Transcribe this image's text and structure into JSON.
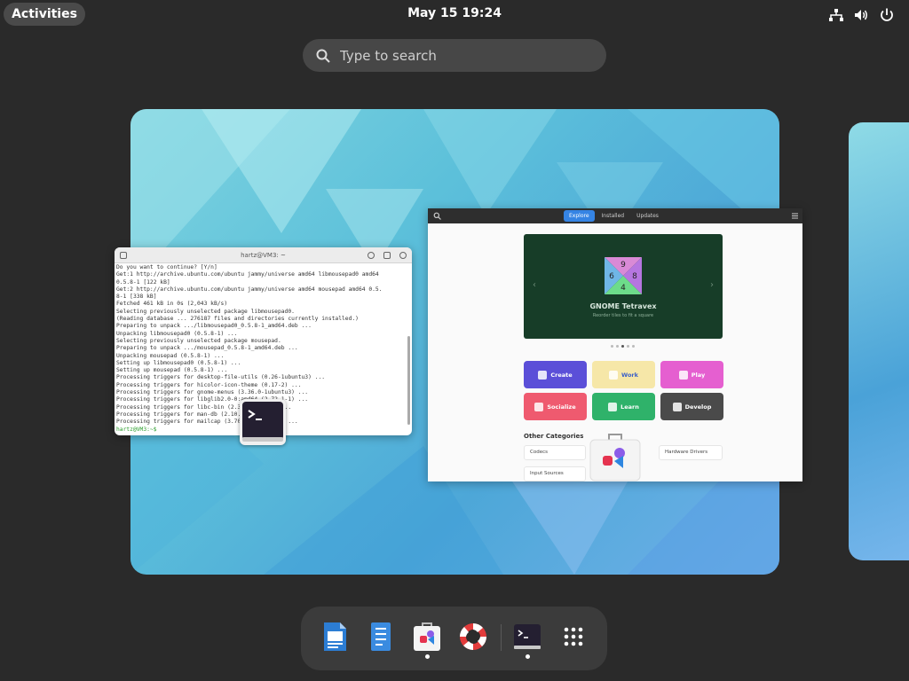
{
  "topbar": {
    "activities_label": "Activities",
    "clock": "May 15  19:24",
    "tray_icons": [
      "network-icon",
      "volume-icon",
      "power-icon"
    ]
  },
  "search": {
    "placeholder": "Type to search"
  },
  "windows": {
    "terminal": {
      "title": "hartz@VM3: ~",
      "lines": [
        "Do you want to continue? [Y/n]",
        "Get:1 http://archive.ubuntu.com/ubuntu jammy/universe amd64 libmousepad0 amd64",
        "0.5.8-1 [122 kB]",
        "Get:2 http://archive.ubuntu.com/ubuntu jammy/universe amd64 mousepad amd64 0.5.",
        "8-1 [338 kB]",
        "Fetched 461 kB in 0s (2,043 kB/s)",
        "Selecting previously unselected package libmousepad0.",
        "(Reading database ... 276187 files and directories currently installed.)",
        "Preparing to unpack .../libmousepad0_0.5.8-1_amd64.deb ...",
        "Unpacking libmousepad0 (0.5.8-1) ...",
        "Selecting previously unselected package mousepad.",
        "Preparing to unpack .../mousepad_0.5.8-1_amd64.deb ...",
        "Unpacking mousepad (0.5.8-1) ...",
        "Setting up libmousepad0 (0.5.8-1) ...",
        "Setting up mousepad (0.5.8-1) ...",
        "Processing triggers for desktop-file-utils (0.26-1ubuntu3) ...",
        "Processing triggers for hicolor-icon-theme (0.17-2) ...",
        "Processing triggers for gnome-menus (3.36.0-1ubuntu3) ...",
        "Processing triggers for libglib2.0-0:amd64 (2.72.1-1) ...",
        "Processing triggers for libc-bin (2.35-0ubuntu3) ...",
        "Processing triggers for man-db (2.10.2-1) ...",
        "Processing triggers for mailcap (3.70+nmu1ubuntu1) ..."
      ],
      "prompt": "hartz@VM3:~$ "
    },
    "software": {
      "tabs": [
        "Explore",
        "Installed",
        "Updates"
      ],
      "featured_title": "GNOME Tetravex",
      "featured_subtitle": "Reorder tiles to fit a square",
      "tile_digits": [
        "9",
        "6",
        "8",
        "4"
      ],
      "categories": [
        {
          "label": "Create",
          "color": "#5b4fd8"
        },
        {
          "label": "Work",
          "color": "#f6e7a8"
        },
        {
          "label": "Play",
          "color": "#e55fd0"
        },
        {
          "label": "Socialize",
          "color": "#ef5a6f"
        },
        {
          "label": "Learn",
          "color": "#2fb26a"
        },
        {
          "label": "Develop",
          "color": "#4a4a4a"
        }
      ],
      "other_categories_heading": "Other Categories",
      "other_categories": [
        "Codecs",
        "Hardware Drivers",
        "Input Sources"
      ]
    }
  },
  "dash": {
    "apps": [
      {
        "name": "libreoffice-writer-icon",
        "running": false
      },
      {
        "name": "text-editor-icon",
        "running": false
      },
      {
        "name": "software-icon",
        "running": true
      },
      {
        "name": "help-icon",
        "running": false
      },
      {
        "name": "terminal-icon",
        "running": true
      },
      {
        "name": "show-apps-icon",
        "running": false
      }
    ]
  },
  "colors": {
    "panel_bg": "#2a2a2a",
    "accent": "#3584e4",
    "dash_bg": "#3b3b3b"
  }
}
